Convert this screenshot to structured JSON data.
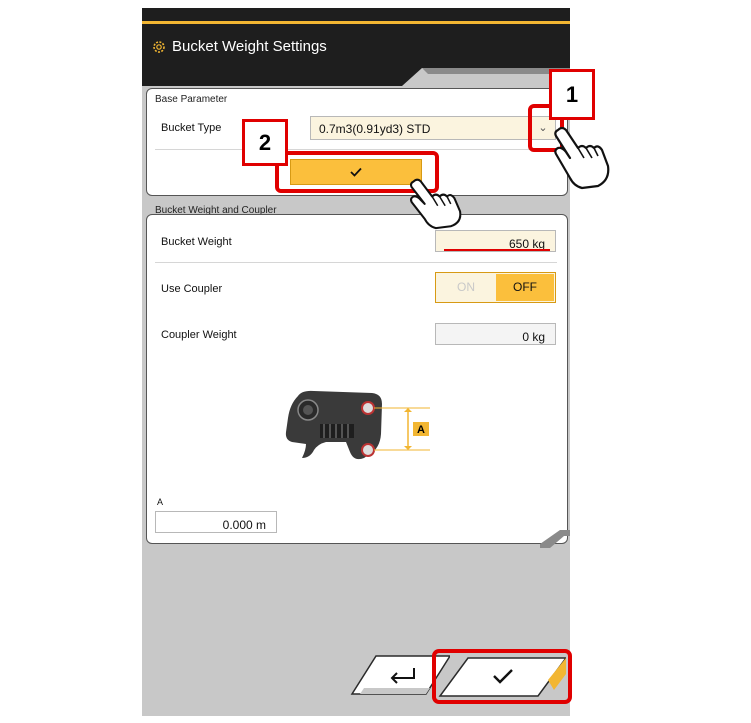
{
  "header": {
    "title": "Bucket Weight Settings",
    "icon": "gear-icon"
  },
  "base_parameter": {
    "section_title": "Base Parameter",
    "bucket_type_label": "Bucket Type",
    "bucket_type_value": "0.7m3(0.91yd3) STD",
    "dropdown_icon": "chevron-down-icon",
    "confirm_icon": "check-icon"
  },
  "bucket_weight_coupler": {
    "section_title": "Bucket Weight and Coupler",
    "bucket_weight_label": "Bucket Weight",
    "bucket_weight_value": "650 kg",
    "use_coupler_label": "Use Coupler",
    "toggle_on": "ON",
    "toggle_off": "OFF",
    "coupler_weight_label": "Coupler Weight",
    "coupler_weight_value": "0 kg",
    "diagram_label": "A",
    "a_label": "A",
    "a_value": "0.000 m"
  },
  "footer": {
    "back_icon": "return-icon",
    "ok_icon": "check-icon"
  },
  "callouts": {
    "step1": "1",
    "step2": "2"
  },
  "colors": {
    "accent": "#f2b632",
    "highlight": "#e00000",
    "header_bg": "#1e1e1e"
  }
}
